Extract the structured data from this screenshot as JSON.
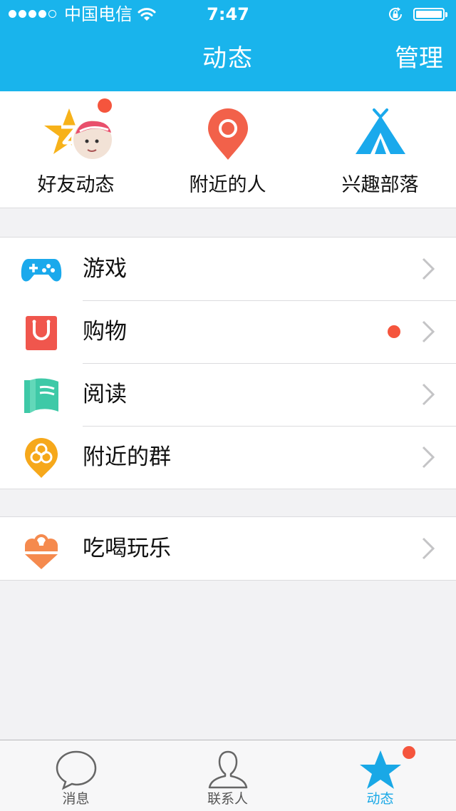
{
  "status_bar": {
    "carrier": "中国电信",
    "time": "7:47",
    "signal_bars": 4
  },
  "nav": {
    "title": "动态",
    "manage_label": "管理"
  },
  "quick_entries": [
    {
      "label": "好友动态",
      "icon": "qzone-star-avatar-icon",
      "badge": true
    },
    {
      "label": "附近的人",
      "icon": "location-pin-icon",
      "badge": false
    },
    {
      "label": "兴趣部落",
      "icon": "tribe-tent-icon",
      "badge": false
    }
  ],
  "menu_groups": [
    [
      {
        "label": "游戏",
        "icon": "gamepad-icon",
        "badge": false
      },
      {
        "label": "购物",
        "icon": "shopping-bag-icon",
        "badge": true
      },
      {
        "label": "阅读",
        "icon": "book-icon",
        "badge": false
      },
      {
        "label": "附近的群",
        "icon": "group-pin-icon",
        "badge": false
      }
    ],
    [
      {
        "label": "吃喝玩乐",
        "icon": "ice-cream-icon",
        "badge": false
      }
    ]
  ],
  "tabbar": [
    {
      "label": "消息",
      "icon": "chat-bubble-icon",
      "active": false
    },
    {
      "label": "联系人",
      "icon": "contact-person-icon",
      "active": false
    },
    {
      "label": "动态",
      "icon": "star-icon",
      "active": true,
      "badge": true
    }
  ],
  "colors": {
    "accent": "#19b4ec",
    "badge": "#f5553d",
    "game": "#1aa9ec",
    "shopping": "#f0564d",
    "reading": "#3ec9a7",
    "nearby_group": "#f6a81b",
    "food": "#f58a4e"
  }
}
